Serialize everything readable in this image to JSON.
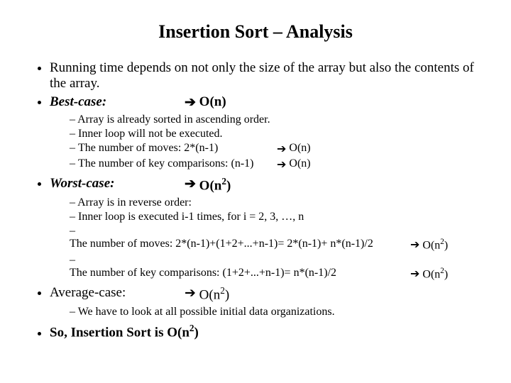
{
  "title": "Insertion Sort – Analysis",
  "b1": "Running time depends on not only the size of the array but also the contents of the array.",
  "best": {
    "label": "Best-case:",
    "arrow": "➔",
    "complexity_pre": "O(n)",
    "s1": "Array is already sorted in ascending order.",
    "s2": "Inner loop will not be executed.",
    "s3_left": "The number of moves: 2*(n-1)",
    "s3_arrow": "➔",
    "s3_right": "O(n)",
    "s4_left": "The number of key comparisons: (n-1)",
    "s4_arrow": "➔",
    "s4_right": "O(n)"
  },
  "worst": {
    "label": "Worst-case:",
    "arrow": "➔",
    "complexity_pre": "O(n",
    "complexity_sup": "2",
    "complexity_post": ")",
    "s1": "Array is in reverse order:",
    "s2": "Inner loop is executed i-1 times, for i = 2, 3, …, n",
    "s3_left": "The number of moves: 2*(n-1)+(1+2+...+n-1)= 2*(n-1)+ n*(n-1)/2",
    "s3_arrow": "➔",
    "s3_right_pre": "O(n",
    "s3_right_sup": "2",
    "s3_right_post": ")",
    "s4_left": "The number of key comparisons: (1+2+...+n-1)= n*(n-1)/2",
    "s4_arrow": "➔",
    "s4_right_pre": "O(n",
    "s4_right_sup": "2",
    "s4_right_post": ")"
  },
  "avg": {
    "label": "Average-case:",
    "arrow": "➔",
    "complexity_pre": "O(n",
    "complexity_sup": "2",
    "complexity_post": ")",
    "s1": "We have to look at all possible initial data organizations."
  },
  "so": {
    "pre": "So, Insertion Sort is O(n",
    "sup": "2",
    "post": ")"
  }
}
